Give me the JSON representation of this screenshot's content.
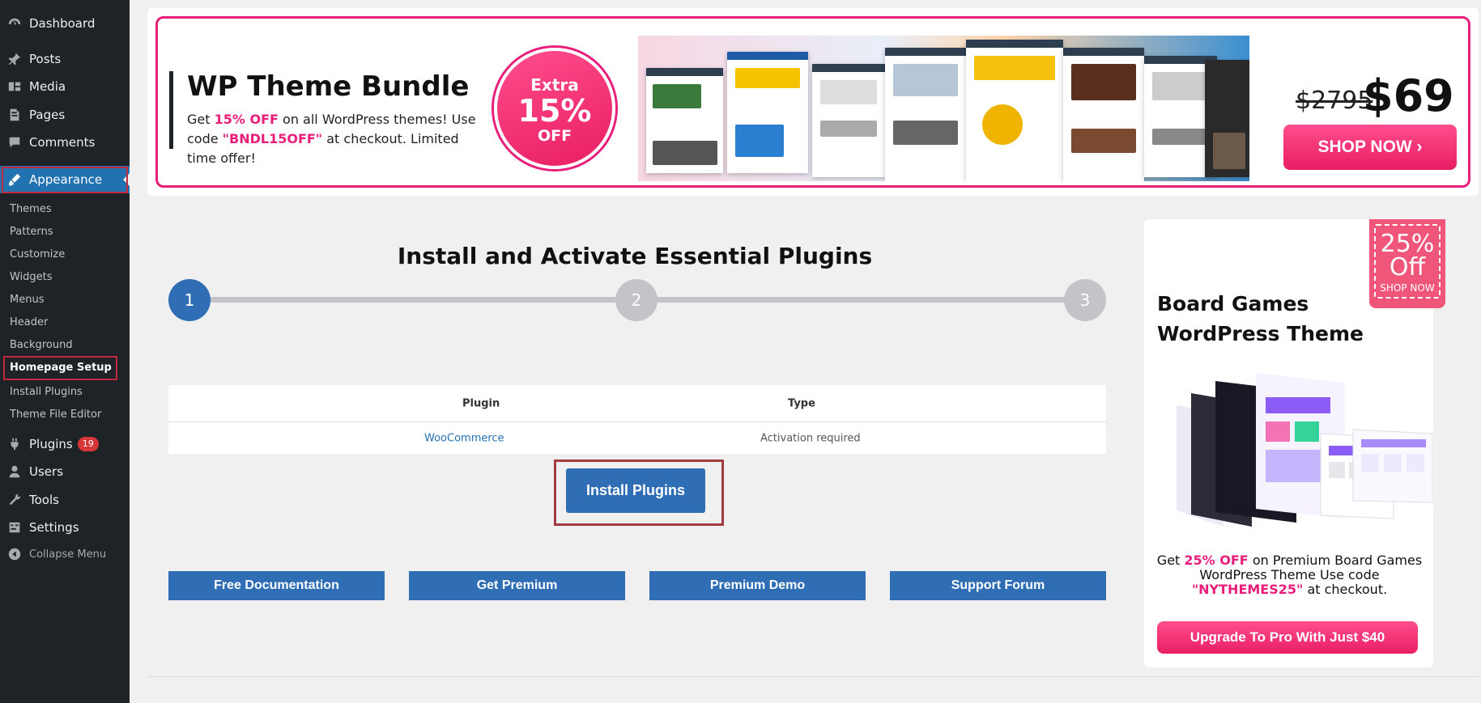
{
  "sidebar": {
    "items": [
      {
        "label": "Dashboard",
        "icon": "dashboard-icon"
      },
      {
        "label": "Posts",
        "icon": "pin-icon"
      },
      {
        "label": "Media",
        "icon": "media-icon"
      },
      {
        "label": "Pages",
        "icon": "pages-icon"
      },
      {
        "label": "Comments",
        "icon": "comment-icon"
      },
      {
        "label": "Appearance",
        "icon": "brush-icon"
      },
      {
        "label": "Plugins",
        "icon": "plug-icon",
        "badge": "19"
      },
      {
        "label": "Users",
        "icon": "user-icon"
      },
      {
        "label": "Tools",
        "icon": "wrench-icon"
      },
      {
        "label": "Settings",
        "icon": "sliders-icon"
      },
      {
        "label": "Collapse Menu",
        "icon": "collapse-icon"
      }
    ],
    "submenu": [
      "Themes",
      "Patterns",
      "Customize",
      "Widgets",
      "Menus",
      "Header",
      "Background",
      "Homepage Setup",
      "Install Plugins",
      "Theme File Editor"
    ]
  },
  "banner": {
    "title": "WP Theme Bundle",
    "desc_pre": "Get ",
    "desc_pct": "15% OFF",
    "desc_mid": " on all WordPress themes! Use code ",
    "desc_code": "\"BNDL15OFF\"",
    "desc_post": " at checkout. Limited time offer!",
    "circle_top": "Extra",
    "circle_mid": "15%",
    "circle_bot": "OFF",
    "old_price": "$2795",
    "new_price": "$69",
    "shop_label": "SHOP NOW ›"
  },
  "main": {
    "title": "Install and Activate Essential Plugins",
    "steps": [
      "1",
      "2",
      "3"
    ],
    "table": {
      "headers": [
        "Plugin",
        "Type"
      ],
      "rows": [
        {
          "plugin": "WooCommerce",
          "type": "Activation required"
        }
      ]
    },
    "install_label": "Install Plugins",
    "links": [
      "Free Documentation",
      "Get Premium",
      "Premium Demo",
      "Support Forum"
    ]
  },
  "promo": {
    "ribbon_pct": "25%",
    "ribbon_off": "Off",
    "ribbon_shop": "SHOP NOW",
    "title": "Board Games WordPress Theme",
    "desc_pre": "Get ",
    "desc_pct": "25% OFF",
    "desc_mid": " on Premium Board Games WordPress Theme Use code ",
    "desc_code": "\"NYTHEMES25\"",
    "desc_post": " at checkout.",
    "button_label": "Upgrade To Pro With Just $40"
  },
  "colors": {
    "sidebar_bg": "#1d2327",
    "active_blue": "#2271b1",
    "button_blue": "#2f6eb5",
    "accent_pink": "#e91e7a",
    "highlight_red": "#c0293e"
  }
}
